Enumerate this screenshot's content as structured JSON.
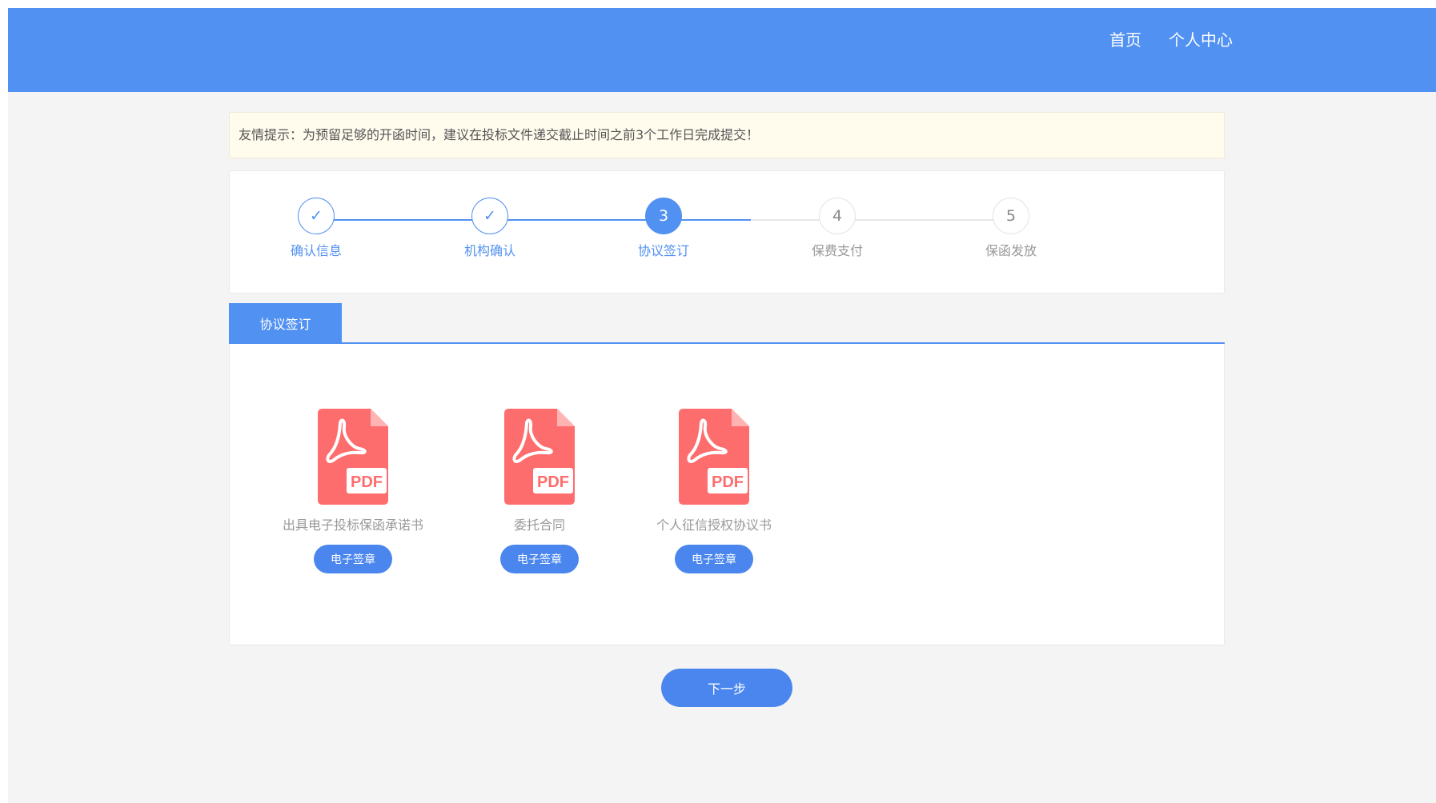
{
  "nav": {
    "home": "首页",
    "profile": "个人中心"
  },
  "notice": {
    "text": "友情提示：为预留足够的开函时间，建议在投标文件递交截止时间之前3个工作日完成提交！"
  },
  "steps": [
    {
      "label": "确认信息",
      "status": "done",
      "mark": "✓"
    },
    {
      "label": "机构确认",
      "status": "done",
      "mark": "✓"
    },
    {
      "label": "协议签订",
      "status": "active",
      "mark": "3"
    },
    {
      "label": "保费支付",
      "status": "pending",
      "mark": "4"
    },
    {
      "label": "保函发放",
      "status": "pending",
      "mark": "5"
    }
  ],
  "tab": {
    "label": "协议签订"
  },
  "docs": [
    {
      "icon": "pdf-file-icon",
      "badge": "PDF",
      "name": "出具电子投标保函承诺书",
      "button": "电子签章"
    },
    {
      "icon": "pdf-file-icon",
      "badge": "PDF",
      "name": "委托合同",
      "button": "电子签章"
    },
    {
      "icon": "pdf-file-icon",
      "badge": "PDF",
      "name": "个人征信授权协议书",
      "button": "电子签章"
    }
  ],
  "next_button": "下一步",
  "colors": {
    "primary": "#5191f1",
    "button": "#4a86ee",
    "pdf": "#fe6d6d",
    "notice_bg": "#fffbed"
  }
}
